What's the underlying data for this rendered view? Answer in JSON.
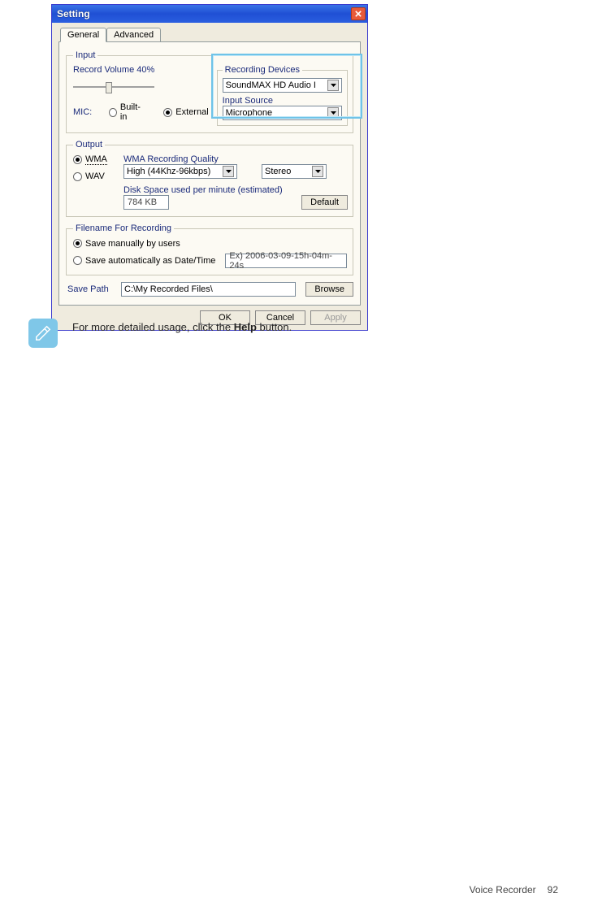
{
  "dialog": {
    "title": "Setting",
    "tabs": {
      "general": "General",
      "advanced": "Advanced"
    },
    "input": {
      "legend": "Input",
      "record_volume_label": "Record Volume 40%",
      "slider_percent": 40,
      "mic_label": "MIC:",
      "builtin": "Built-in",
      "external": "External",
      "mic_selected": "external",
      "recording_devices": {
        "legend": "Recording Devices",
        "device": "SoundMAX HD Audio I",
        "input_source_label": "Input Source",
        "input_source": "Microphone"
      }
    },
    "output": {
      "legend": "Output",
      "wma": "WMA",
      "wav": "WAV",
      "selected_format": "wma",
      "quality_label": "WMA Recording Quality",
      "quality": "High (44Khz-96kbps)",
      "channels": "Stereo",
      "disk_label": "Disk Space used per minute (estimated)",
      "disk_value": "784 KB",
      "default_btn": "Default"
    },
    "filename": {
      "legend": "Filename For Recording",
      "manual": "Save manually by users",
      "auto": "Save automatically as Date/Time",
      "selected": "manual",
      "example": "Ex) 2006-03-09-15h-04m-24s"
    },
    "save_path": {
      "label": "Save Path",
      "value": "C:\\My Recorded Files\\",
      "browse": "Browse"
    },
    "buttons": {
      "ok": "OK",
      "cancel": "Cancel",
      "apply": "Apply"
    }
  },
  "note": {
    "text_prefix": "For more detailed usage, click the ",
    "bold": "Help",
    "text_suffix": " button."
  },
  "footer": {
    "section": "Voice Recorder",
    "page": "92"
  }
}
